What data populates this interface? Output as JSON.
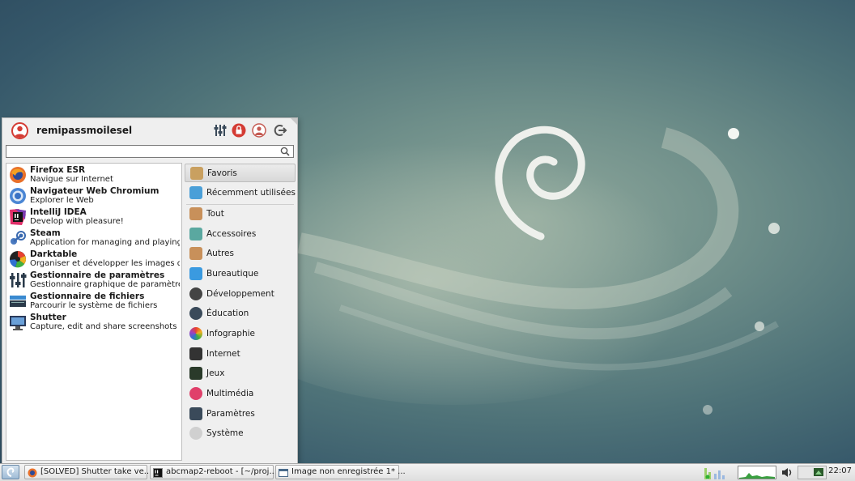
{
  "menu": {
    "username": "remipassmoilesel",
    "search": {
      "value": "",
      "placeholder": ""
    },
    "header_icons": [
      "settings-sliders-icon",
      "lock-icon",
      "user-switch-icon",
      "logout-icon"
    ],
    "apps": [
      {
        "name": "Firefox ESR",
        "description": "Navigue sur Internet",
        "icon": "firefox-icon"
      },
      {
        "name": "Navigateur Web Chromium",
        "description": "Explorer le Web",
        "icon": "chromium-icon"
      },
      {
        "name": "IntelliJ IDEA",
        "description": "Develop with pleasure!",
        "icon": "intellij-icon"
      },
      {
        "name": "Steam",
        "description": "Application for managing and playing...",
        "icon": "steam-icon"
      },
      {
        "name": "Darktable",
        "description": "Organiser et développer les images d'...",
        "icon": "darktable-icon"
      },
      {
        "name": "Gestionnaire de paramètres",
        "description": "Gestionnaire graphique de paramètre...",
        "icon": "settings-manager-icon"
      },
      {
        "name": "Gestionnaire de fichiers",
        "description": "Parcourir le système de fichiers",
        "icon": "file-manager-icon"
      },
      {
        "name": "Shutter",
        "description": "Capture, edit and share screenshots",
        "icon": "shutter-icon"
      }
    ],
    "categories": [
      {
        "label": "Favoris",
        "icon": "favorites-icon",
        "color": "#c9a060",
        "active": true
      },
      {
        "label": "Récemment utilisées",
        "icon": "recent-icon",
        "color": "#4a9fd8"
      },
      {
        "label": "Tout",
        "icon": "all-icon",
        "color": "#c8905a"
      },
      {
        "label": "Accessoires",
        "icon": "accessories-icon",
        "color": "#5aa8a0"
      },
      {
        "label": "Autres",
        "icon": "other-icon",
        "color": "#c8905a"
      },
      {
        "label": "Bureautique",
        "icon": "office-icon",
        "color": "#3a9ae0"
      },
      {
        "label": "Développement",
        "icon": "development-icon",
        "color": "#444444"
      },
      {
        "label": "Éducation",
        "icon": "education-icon",
        "color": "#3a4a5a"
      },
      {
        "label": "Infographie",
        "icon": "graphics-icon",
        "color": "#e0608a"
      },
      {
        "label": "Internet",
        "icon": "internet-icon",
        "color": "#333333"
      },
      {
        "label": "Jeux",
        "icon": "games-icon",
        "color": "#2a3a2a"
      },
      {
        "label": "Multimédia",
        "icon": "multimedia-icon",
        "color": "#e0406a"
      },
      {
        "label": "Paramètres",
        "icon": "settings-icon",
        "color": "#3a4a5a"
      },
      {
        "label": "Système",
        "icon": "system-icon",
        "color": "#c8c8c8"
      }
    ]
  },
  "taskbar": {
    "tasks": [
      {
        "label": "[SOLVED] Shutter take ve...",
        "icon": "firefox-icon"
      },
      {
        "label": "abcmap2-reboot - [~/proj...",
        "icon": "intellij-icon"
      },
      {
        "label": "Image non enregistrée 1* ...",
        "icon": "window-icon"
      }
    ],
    "clock": "22:07"
  },
  "colors": {
    "accent": "#d43c34",
    "wallpaper": "#4e7278"
  }
}
